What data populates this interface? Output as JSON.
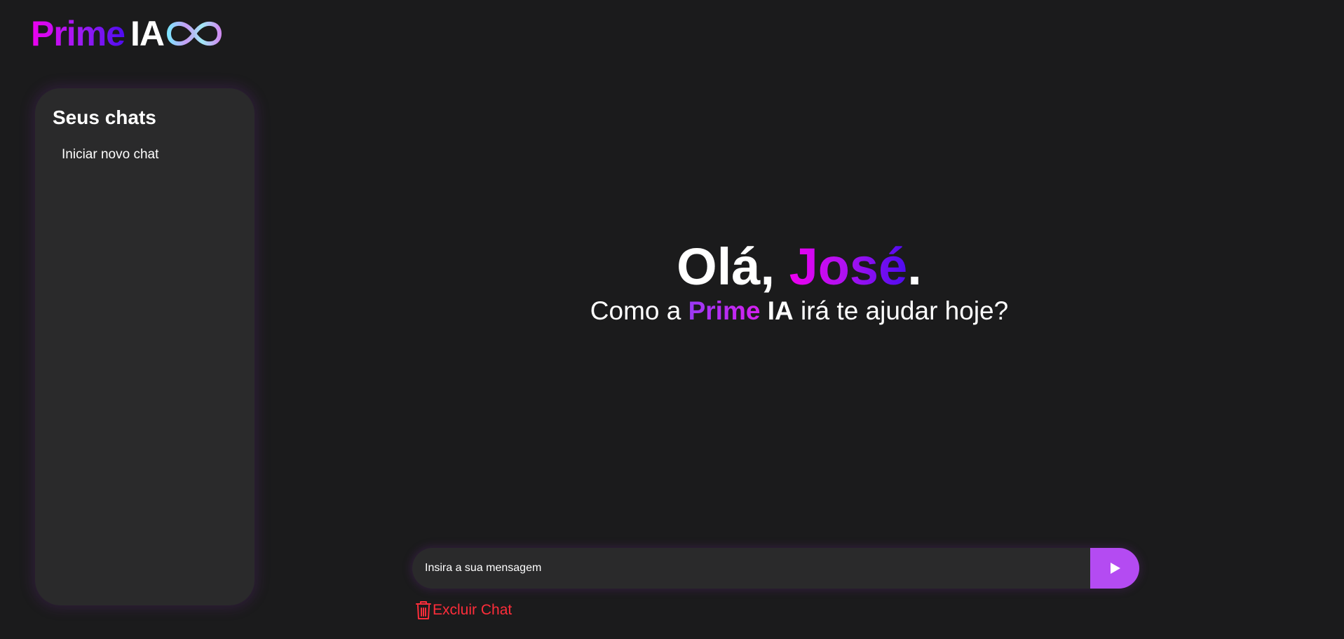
{
  "logo": {
    "prime": "Prime",
    "ia": "IA",
    "icon": "infinity-icon"
  },
  "sidebar": {
    "title": "Seus chats",
    "new_chat_label": "Iniciar novo chat"
  },
  "greeting": {
    "hello": "Olá, ",
    "name": "José",
    "punct": ".",
    "line2_prefix": "Como a ",
    "line2_prime": "Prime",
    "line2_ia": "IA",
    "line2_suffix": " irá te ajudar hoje?"
  },
  "composer": {
    "placeholder": "Insira a sua mensagem",
    "send_icon": "play-icon"
  },
  "delete_chat": {
    "label": "Excluir Chat",
    "icon": "trash-icon"
  },
  "colors": {
    "background": "#1b1b1c",
    "panel": "#2a2a2b",
    "accent": "#b44bf2",
    "gradient_start": "#ee00f0",
    "gradient_end": "#4d0bf0",
    "danger": "#ff2d3a"
  }
}
